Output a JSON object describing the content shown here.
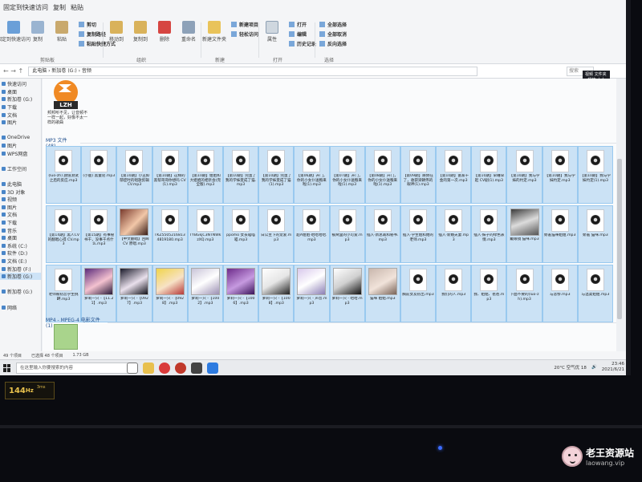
{
  "ribbon": {
    "quick_access": [
      "固定到快速访问",
      "复制",
      "粘贴"
    ],
    "groups": [
      {
        "title": "剪贴板",
        "buttons": [
          "固定到快速访问",
          "复制",
          "粘贴"
        ],
        "list": [
          "剪切",
          "复制路径",
          "粘贴快捷方式"
        ]
      },
      {
        "title": "组织",
        "buttons": [
          "移动到",
          "复制到",
          "删除",
          "重命名"
        ],
        "list": []
      },
      {
        "title": "新建",
        "buttons": [
          "新建文件夹"
        ],
        "list": [
          "新建项目",
          "轻松访问"
        ]
      },
      {
        "title": "打开",
        "buttons": [
          "属性"
        ],
        "list": [
          "打开",
          "编辑",
          "历史记录"
        ]
      },
      {
        "title": "选择",
        "buttons": [],
        "list": [
          "全部选择",
          "全部取消",
          "反向选择"
        ]
      }
    ]
  },
  "address": {
    "nav": "←  →  ↑",
    "path": "此电脑 › 新加卷 (G:) › 音频",
    "search_placeholder": "搜索",
    "tooltip": "视频 文件夹 - 播放 大小"
  },
  "sidebar": {
    "items": [
      "快速访问",
      "桌面",
      "新加卷 (G:)",
      "下载",
      "文档",
      "图片",
      "",
      "OneDrive",
      "图片",
      "WPS网盘",
      "",
      "工作空间",
      "",
      "此电脑",
      "3D 对象",
      "视频",
      "图片",
      "文档",
      "下载",
      "音乐",
      "桌面",
      "系统 (C:)",
      "软件 (D:)",
      "文档 (E:)",
      "新加卷 (F:)",
      "新加卷 (G:)",
      "",
      "新加卷 (G:)",
      "",
      "网络"
    ],
    "selected_index": 25
  },
  "content": {
    "top_file": {
      "tag": "LZH",
      "caption": "邦邦听不见，让音频不一样一起，好像不太一样的歌曲"
    },
    "group_mp3": "MP3 文件 (48)",
    "group_mp4": "MP4 - MPEG-4 电影文件 (1)",
    "rows": [
      [
        {
          "name": "(luo-zh) 颜值测试之后的反应.mp3",
          "kind": "mp3"
        },
        {
          "name": "(小鹿) 黑童谣.mp3",
          "kind": "mp3"
        },
        {
          "name": "【第10期】小丑抑郁症时的唱歌剪辑 CV.mp3",
          "kind": "mp3"
        },
        {
          "name": "【第10期】这样的黑帮哥哥你想吗 CV(1).mp3",
          "kind": "mp3"
        },
        {
          "name": "【第10期】姐姐和大姐姐的相亲会(完全版).mp3",
          "kind": "mp3"
        },
        {
          "name": "【第10期】完蛋了我的学妹变成了猫.mp3",
          "kind": "mp3"
        },
        {
          "name": "【第10期】完蛋了我的学妹变成了猫(1).mp3",
          "kind": "mp3"
        },
        {
          "name": "【第06期】开门，你的小女仆送粮来啦(1).mp3",
          "kind": "mp3"
        },
        {
          "name": "【第07期】开门，你的小女仆送粮来啦(1).mp3",
          "kind": "mp3"
        },
        {
          "name": "【第08期】开门，你的小女仆送粮来啦(1).mp3",
          "kind": "mp3"
        },
        {
          "name": "【第09期】跌倒在了，收获梁朝伟的眼神(1).mp3",
          "kind": "mp3"
        },
        {
          "name": "【第10期】富家千金的第一次.mp3",
          "kind": "mp3"
        },
        {
          "name": "【第10期】早睡早起 CV剧(1).mp3",
          "kind": "mp3"
        },
        {
          "name": "【第10期】我与学妹的约定.mp3",
          "kind": "mp3"
        },
        {
          "name": "【第10期】我与学妹约定.mp3",
          "kind": "mp3"
        },
        {
          "name": "【第10期】我与学妹约定(1).mp3",
          "kind": "mp3"
        }
      ],
      [
        {
          "name": "【第14期】黑人CV的翻唱心得 CV.mp3",
          "kind": "mp3"
        },
        {
          "name": "【第15期】有事秘书干，没事干点什么.mp3",
          "kind": "mp3"
        },
        {
          "name": "【中文翻唱】回眸 CV 原唱.mp3",
          "kind": "img1"
        },
        {
          "name": "TKZ55052168134819180.mp3",
          "kind": "mp3"
        },
        {
          "name": "TYBGkjC3NTNWkzXQ.mp3",
          "kind": "mp3"
        },
        {
          "name": "ppomo 女孩喵喵喵.mp3",
          "kind": "mp3"
        },
        {
          "name": "白公主下的宠爱.mp3",
          "kind": "mp3"
        },
        {
          "name": "超A姐姐·哈哈哈哈.mp3",
          "kind": "mp3"
        },
        {
          "name": "被窝里的小可爱.mp3",
          "kind": "mp3"
        },
        {
          "name": "插入·新总裁和秘书.mp3",
          "kind": "mp3"
        },
        {
          "name": "插入·学生姐和她的老师.mp3",
          "kind": "mp3"
        },
        {
          "name": "插入·新婚夫妻.mp3",
          "kind": "mp3"
        },
        {
          "name": "插入·妹子的绿色表情.mp3",
          "kind": "mp3"
        },
        {
          "name": "戴眼镜 猫咪.mp3",
          "kind": "img2"
        },
        {
          "name": "娇羞猫咪姐姐.mp3",
          "kind": "mp3"
        },
        {
          "name": "娇羞 猫咪.mp3",
          "kind": "mp3"
        }
      ],
      [
        {
          "name": "老师被初恋学生挑衅.mp3",
          "kind": "mp3"
        },
        {
          "name": "萝莉一只 -【11.21】.mp3",
          "kind": "img3"
        },
        {
          "name": "萝莉一只 -【0927】.mp3",
          "kind": "img4"
        },
        {
          "name": "萝莉一只 -【0928】.mp3",
          "kind": "img5"
        },
        {
          "name": "萝莉一只 -【1002】.mp3",
          "kind": "img6"
        },
        {
          "name": "萝莉一只 -【1006】.mp3",
          "kind": "img7"
        },
        {
          "name": "萝莉一只 -【1008】.mp3",
          "kind": "img8"
        },
        {
          "name": "萝莉一只 - 声音.mp3",
          "kind": "img9"
        },
        {
          "name": "萝莉一只 - 哈哈.mp3",
          "kind": "img10"
        },
        {
          "name": "猫咪 姐姐.mp3",
          "kind": "img11"
        },
        {
          "name": "胸前女友初出.mp3",
          "kind": "mp3"
        },
        {
          "name": "我们的人.mp3",
          "kind": "mp3"
        },
        {
          "name": "我、姐姐、爸爸.mp3",
          "kind": "mp3"
        },
        {
          "name": "下面不要的(luo-zh).mp3",
          "kind": "mp3"
        },
        {
          "name": "与悲惨.mp3",
          "kind": "mp3"
        },
        {
          "name": "与温柔姐姐.mp3",
          "kind": "mp3"
        }
      ]
    ]
  },
  "status": {
    "count": "49 个项目",
    "selected": "已选择 48 个项目",
    "size": "1.73 GB"
  },
  "taskbar": {
    "search_placeholder": "在这里输入你要搜索的内容",
    "weather": "20°C 空气优 18",
    "time": "23:46",
    "date": "2021/6/21"
  },
  "bezel": {
    "refresh": "144",
    "refresh_unit": "Hz",
    "response": "3ms"
  },
  "watermark": {
    "line1": "老王资源站",
    "line2": "laowang.vip"
  }
}
